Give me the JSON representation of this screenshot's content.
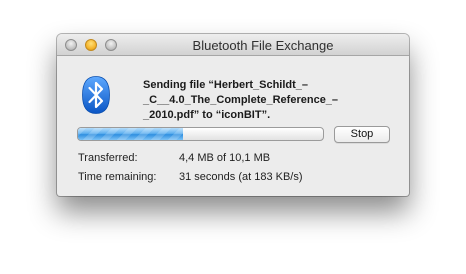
{
  "window": {
    "title": "Bluetooth File Exchange"
  },
  "icons": {
    "app": "bluetooth-icon",
    "close": "close-icon",
    "minimize": "minimize-icon",
    "zoom": "zoom-icon"
  },
  "message": {
    "line1": "Sending file “Herbert_Schildt_–",
    "line2": "_C__4.0_The_Complete_Reference_–",
    "line3": "_2010.pdf” to “iconBIT”."
  },
  "progress": {
    "value": 0.43
  },
  "stop_label": "Stop",
  "transferred": {
    "label": "Transferred:",
    "value": "4,4 MB of 10,1 MB"
  },
  "time_remaining": {
    "label": "Time remaining:",
    "value": "31 seconds (at 183 KB/s)"
  },
  "colors": {
    "window_bg": "#ececec",
    "bluetooth_blue": "#1a73e0",
    "progress_blue": "#4aa3ea",
    "minimize_yellow": "#f5b52c"
  }
}
